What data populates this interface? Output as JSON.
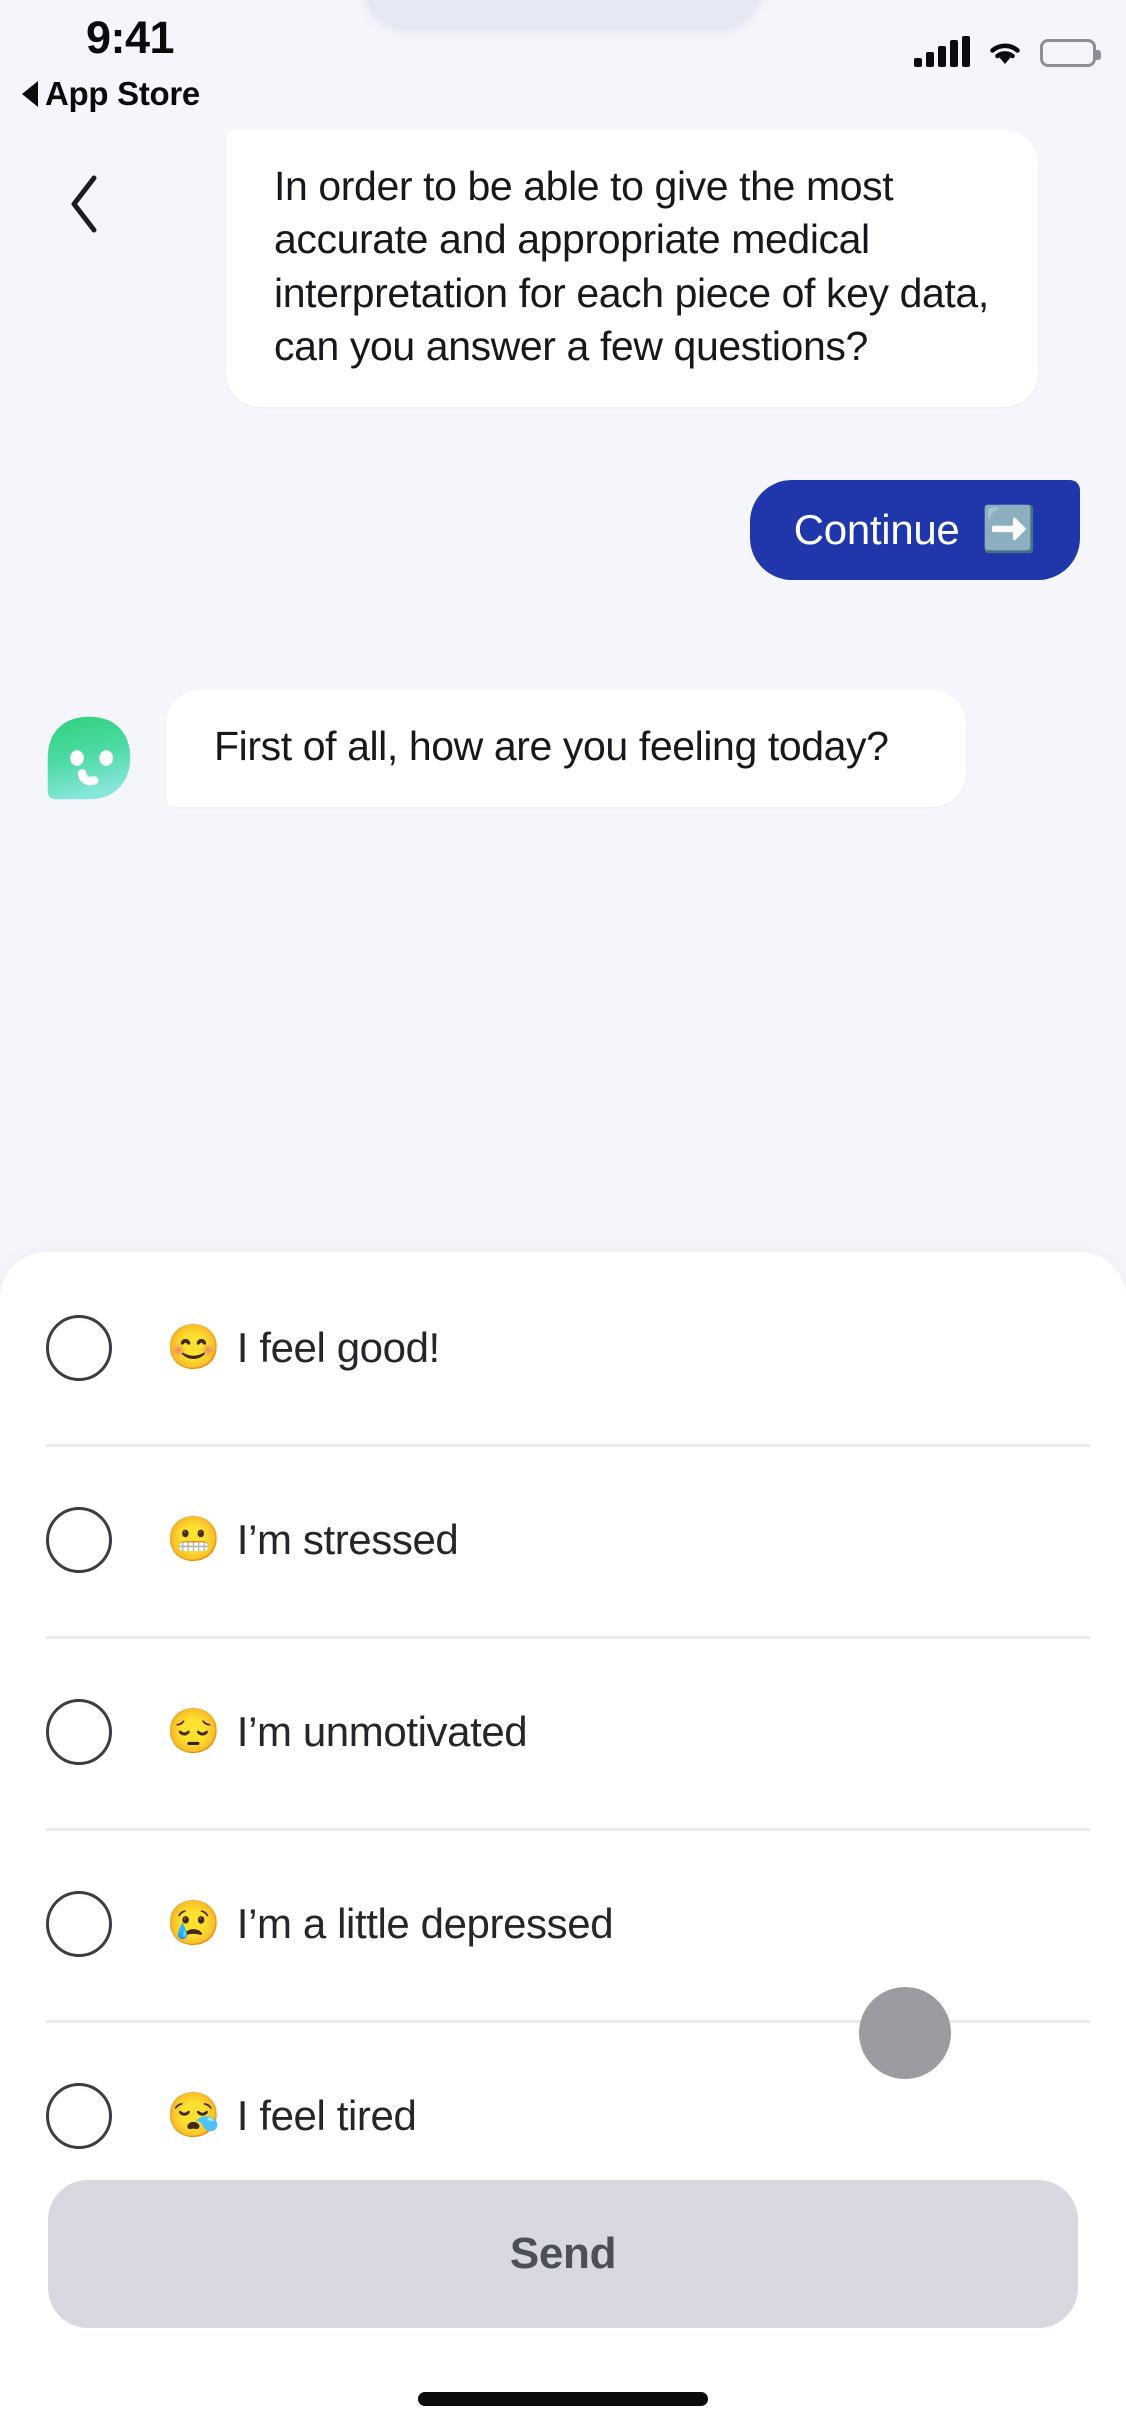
{
  "status_bar": {
    "time": "9:41",
    "back_link": "App Store",
    "icons": {
      "signal": "signal-bars-icon",
      "wifi": "wifi-icon",
      "battery": "battery-full-icon"
    }
  },
  "nav": {
    "back_icon": "chevron-left-icon"
  },
  "conversation": {
    "messages": [
      {
        "sender": "bot",
        "text": "In order to be able to give the most accurate and appropriate medical interpretation for each piece of key data, can you answer a few questions?"
      },
      {
        "sender": "user",
        "text": "Continue",
        "icon": "arrow-right-emoji",
        "icon_glyph": "➡️"
      },
      {
        "sender": "bot",
        "text": "First of all, how are you feeling today?",
        "avatar": "bot-avatar-green-face"
      }
    ]
  },
  "options": {
    "items": [
      {
        "emoji": "😊",
        "emoji_name": "smiling-face-with-smiling-eyes",
        "label": "I feel good!",
        "selected": false
      },
      {
        "emoji": "😬",
        "emoji_name": "grimacing-face",
        "label": "I’m stressed",
        "selected": false
      },
      {
        "emoji": "😔",
        "emoji_name": "pensive-face",
        "label": "I’m unmotivated",
        "selected": false
      },
      {
        "emoji": "😢",
        "emoji_name": "crying-face",
        "label": "I’m a little depressed",
        "selected": false
      },
      {
        "emoji": "😪",
        "emoji_name": "sleepy-face",
        "label": "I feel tired",
        "selected": false
      }
    ]
  },
  "send": {
    "label": "Send"
  },
  "colors": {
    "background": "#f5f6fb",
    "bubble": "#ffffff",
    "accent_blue": "#1f37ab",
    "send_disabled": "#d7d8e0",
    "avatar_green_top": "#34d07f",
    "avatar_green_bottom": "#7fe3d2"
  }
}
